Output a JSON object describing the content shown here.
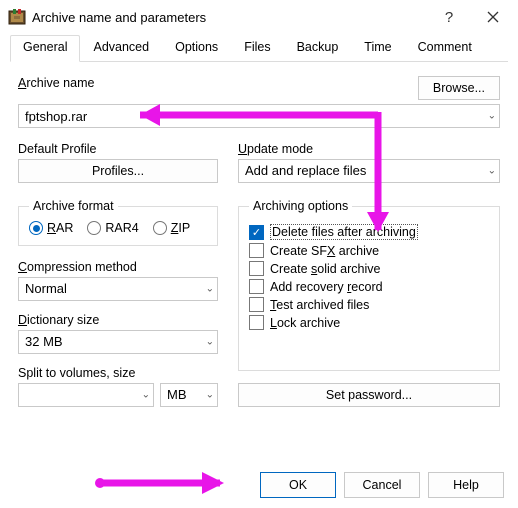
{
  "title": "Archive name and parameters",
  "tabs": [
    "General",
    "Advanced",
    "Options",
    "Files",
    "Backup",
    "Time",
    "Comment"
  ],
  "active_tab": 0,
  "archive_name_label": "Archive name",
  "archive_name_value": "fptshop.rar",
  "browse_label": "Browse...",
  "default_profile_label": "Default Profile",
  "profiles_button": "Profiles...",
  "update_mode_label": "Update mode",
  "update_mode_value": "Add and replace files",
  "archive_format_label": "Archive format",
  "formats": [
    {
      "label": "RAR",
      "selected": true
    },
    {
      "label": "RAR4",
      "selected": false
    },
    {
      "label": "ZIP",
      "selected": false
    }
  ],
  "archiving_options_label": "Archiving options",
  "options": [
    {
      "label": "Delete files after archiving",
      "checked": true
    },
    {
      "label": "Create SFX archive",
      "checked": false
    },
    {
      "label": "Create solid archive",
      "checked": false
    },
    {
      "label": "Add recovery record",
      "checked": false
    },
    {
      "label": "Test archived files",
      "checked": false
    },
    {
      "label": "Lock archive",
      "checked": false
    }
  ],
  "compression_method_label": "Compression method",
  "compression_method_value": "Normal",
  "dictionary_label": "Dictionary size",
  "dictionary_value": "32 MB",
  "split_label": "Split to volumes, size",
  "split_value": "",
  "split_unit": "MB",
  "set_password_label": "Set password...",
  "ok_label": "OK",
  "cancel_label": "Cancel",
  "help_label": "Help",
  "colors": {
    "accent": "#0067c0",
    "annotation": "#e815e8"
  }
}
